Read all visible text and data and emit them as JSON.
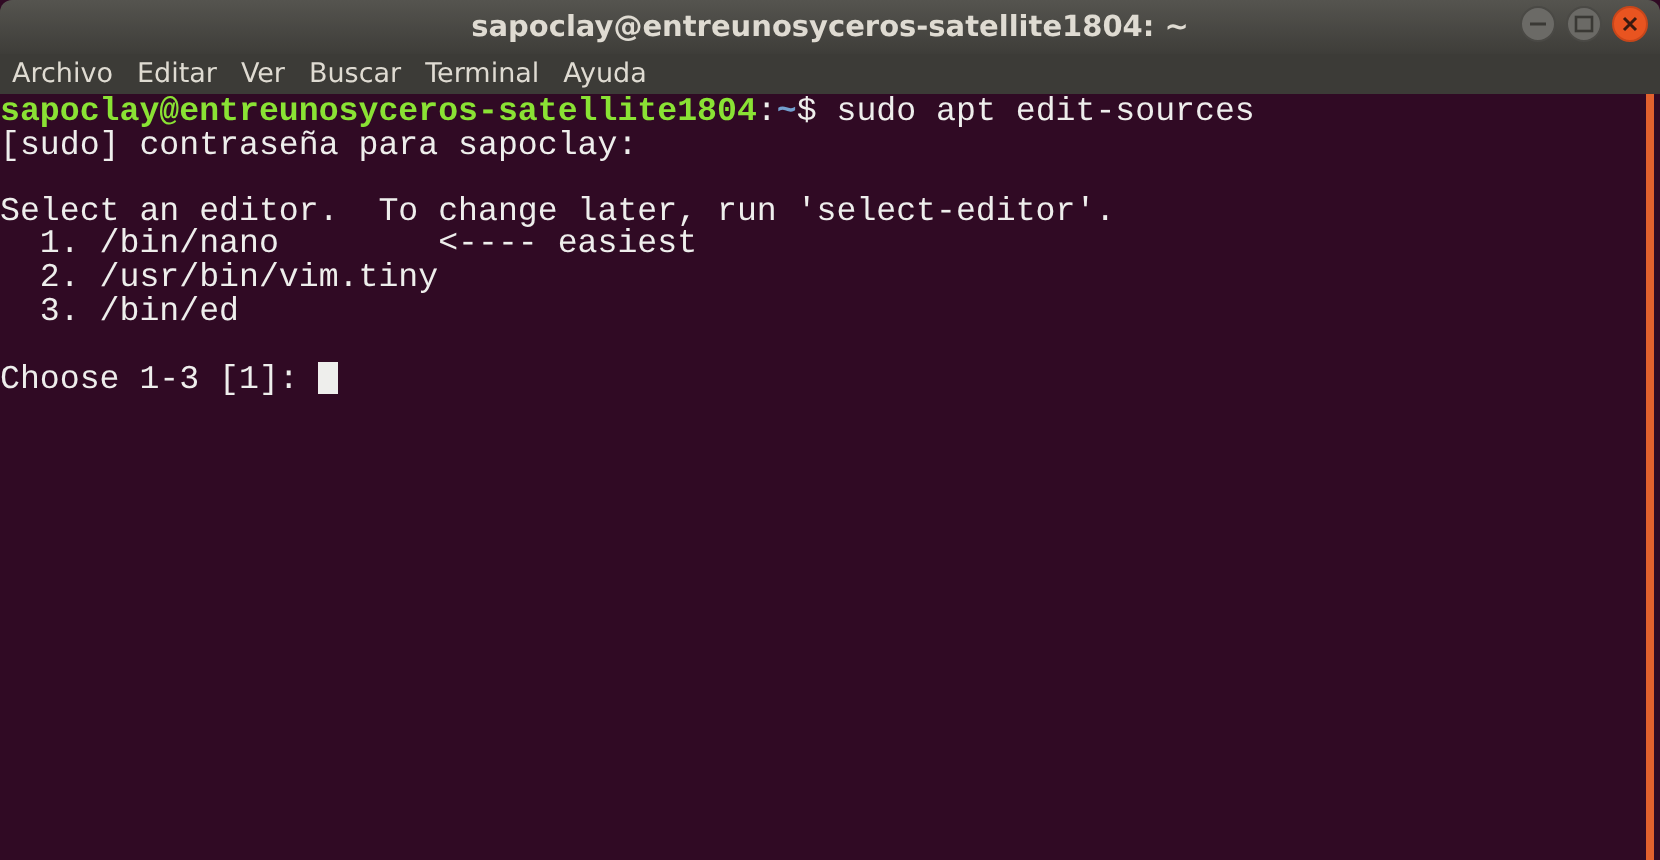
{
  "window": {
    "title": "sapoclay@entreunosyceros-satellite1804: ~"
  },
  "menu": [
    "Archivo",
    "Editar",
    "Ver",
    "Buscar",
    "Terminal",
    "Ayuda"
  ],
  "terminal": {
    "lines": [
      {
        "kind": "prompt",
        "user_host": "sapoclay@entreunosyceros-satellite1804",
        "separator": ":",
        "path": "~",
        "symbol": "$",
        "command": "sudo apt edit-sources"
      },
      {
        "kind": "output",
        "text": "[sudo] contraseña para sapoclay:"
      },
      {
        "kind": "blank"
      },
      {
        "kind": "output",
        "text": "Select an editor.  To change later, run 'select-editor'."
      },
      {
        "kind": "output",
        "text": "  1. /bin/nano        <---- easiest"
      },
      {
        "kind": "output",
        "text": "  2. /usr/bin/vim.tiny"
      },
      {
        "kind": "output",
        "text": "  3. /bin/ed"
      },
      {
        "kind": "blank"
      },
      {
        "kind": "input",
        "text": "Choose 1-3 [1]: ",
        "cursor": true
      }
    ]
  }
}
